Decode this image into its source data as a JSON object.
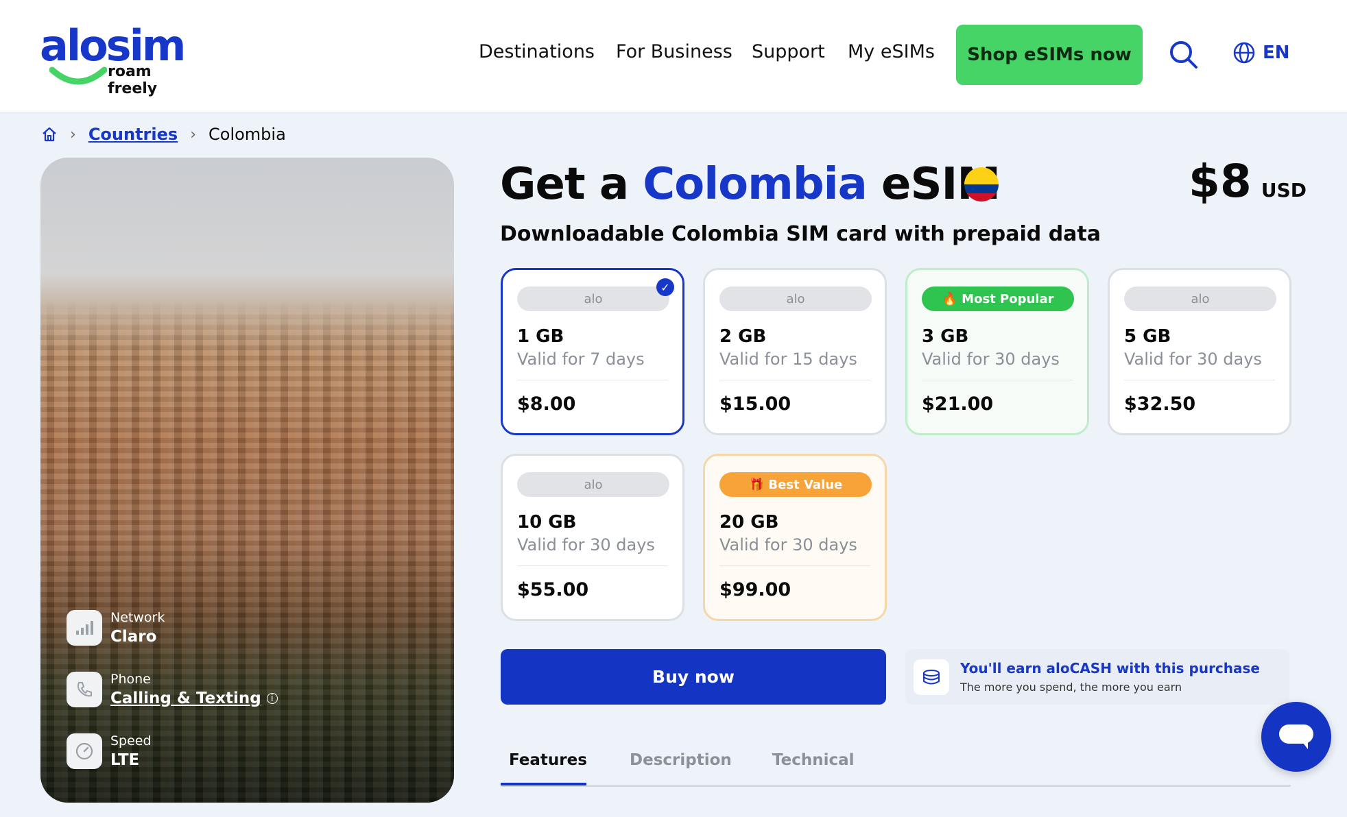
{
  "brand": {
    "name": "alosim",
    "tagline": "roam freely"
  },
  "nav": {
    "items": [
      "Destinations",
      "For Business",
      "Support",
      "My eSIMs"
    ],
    "cta": "Shop eSIMs now",
    "language": "EN"
  },
  "breadcrumb": {
    "countries": "Countries",
    "current": "Colombia"
  },
  "hero": {
    "specs": [
      {
        "label": "Network",
        "value": "Claro"
      },
      {
        "label": "Phone",
        "value": "Calling & Texting"
      },
      {
        "label": "Speed",
        "value": "LTE"
      }
    ]
  },
  "product": {
    "title_prefix": "Get a",
    "title_country": "Colombia",
    "title_suffix": "eSIM",
    "price": "$8",
    "currency": "USD",
    "subtitle": "Downloadable Colombia SIM card with prepaid data"
  },
  "plans": [
    {
      "badge": "alo",
      "data": "1 GB",
      "validity": "Valid for 7 days",
      "price": "$8.00",
      "selected": true
    },
    {
      "badge": "alo",
      "data": "2 GB",
      "validity": "Valid for 15 days",
      "price": "$15.00"
    },
    {
      "badge": "🔥 Most Popular",
      "data": "3 GB",
      "validity": "Valid for 30 days",
      "price": "$21.00"
    },
    {
      "badge": "alo",
      "data": "5 GB",
      "validity": "Valid for 30 days",
      "price": "$32.50"
    },
    {
      "badge": "alo",
      "data": "10 GB",
      "validity": "Valid for 30 days",
      "price": "$55.00"
    },
    {
      "badge": "🎁 Best Value",
      "data": "20 GB",
      "validity": "Valid for 30 days",
      "price": "$99.00"
    }
  ],
  "buy": {
    "label": "Buy now"
  },
  "alocash": {
    "title": "You'll earn aloCASH with this purchase",
    "subtitle": "The more you spend, the more you earn"
  },
  "tabs": [
    "Features",
    "Description",
    "Technical"
  ],
  "colors": {
    "brand_blue": "#1737c8",
    "cta_green": "#45d465",
    "popular_green": "#2ec44f",
    "best_orange": "#f8a338"
  }
}
